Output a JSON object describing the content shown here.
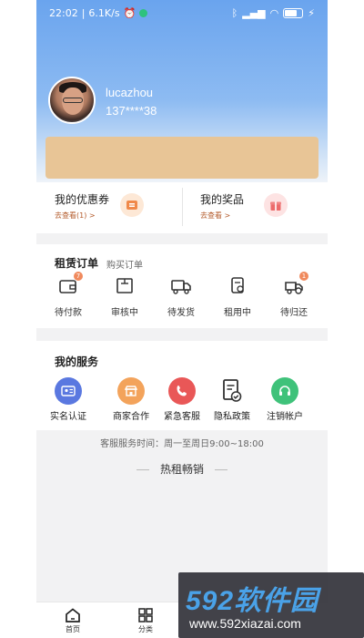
{
  "status_bar": {
    "time": "22:02",
    "speed": "6.1K/s",
    "battery": "29"
  },
  "profile": {
    "username": "lucazhou",
    "phone": "137****38"
  },
  "promo": {
    "coupons": {
      "title": "我的优惠券",
      "link": "去查看(1) >"
    },
    "prizes": {
      "title": "我的奖品",
      "link": "去查看 >"
    }
  },
  "orders": {
    "title": "租赁订单",
    "subtitle": "购买订单",
    "items": [
      {
        "label": "待付款",
        "badge": "7"
      },
      {
        "label": "审核中"
      },
      {
        "label": "待发货"
      },
      {
        "label": "租用中"
      },
      {
        "label": "待归还",
        "badge": "1"
      }
    ]
  },
  "services": {
    "title": "我的服务",
    "items": [
      {
        "label": "实名认证",
        "color": "#5a78e0"
      },
      {
        "label": "商家合作",
        "color": "#f3a35b"
      },
      {
        "label": "紧急客服",
        "color": "#e95757"
      },
      {
        "label": "隐私政策",
        "color": "#333333"
      },
      {
        "label": "注销帐户",
        "color": "#3fc27a"
      }
    ]
  },
  "service_hours": "客服服务时间：周一至周日9:00~18:00",
  "hot_title": "热租畅销",
  "tabbar": {
    "home": "首页",
    "category": "分类"
  },
  "watermark": {
    "brand": "592软件园",
    "url": "www.592xiazai.com"
  }
}
